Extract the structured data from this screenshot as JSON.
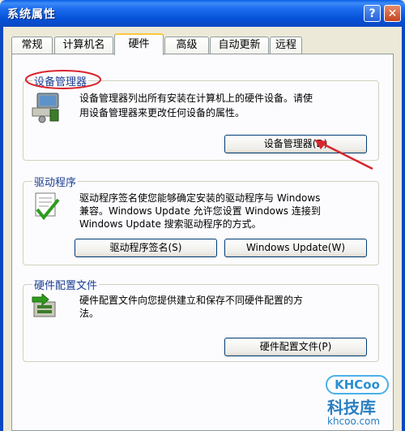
{
  "window": {
    "title": "系统属性",
    "help_button": "?",
    "close_button": "✕"
  },
  "tabs": [
    "常规",
    "计算机名",
    "硬件",
    "高级",
    "自动更新",
    "远程"
  ],
  "active_tab": "硬件",
  "device_manager": {
    "title": "设备管理器",
    "description_line1": "设备管理器列出所有安装在计算机上的硬件设备。请使",
    "description_line2": "用设备管理器来更改任何设备的属性。",
    "button": "设备管理器(D)"
  },
  "drivers": {
    "title": "驱动程序",
    "description_line1": "驱动程序签名使您能够确定安装的驱动程序与 Windows",
    "description_line2": "兼容。Windows Update 允许您设置 Windows 连接到",
    "description_line3": "Windows Update 搜索驱动程序的方式。",
    "signing_button": "驱动程序签名(S)",
    "update_button": "Windows Update(W)"
  },
  "hardware_profiles": {
    "title": "硬件配置文件",
    "description_line1": "硬件配置文件向您提供建立和保存不同硬件配置的方",
    "description_line2": "法。",
    "button": "硬件配置文件(P)"
  },
  "watermark": {
    "logo": "KHCoo",
    "name": "科技库",
    "domain": "khcoo.com"
  },
  "colors": {
    "titlebar": "#0A5DE6",
    "annotation": "#D8262E",
    "tab_highlight": "#FFC73C"
  }
}
